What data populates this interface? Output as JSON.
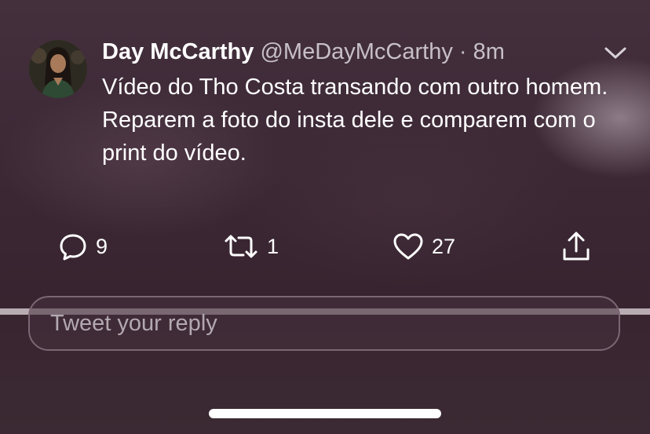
{
  "tweet": {
    "author_name": "Day McCarthy",
    "author_handle": "@MeDayMcCarthy",
    "separator": "·",
    "time": "8m",
    "text": "Vídeo do Tho Costa transando com outro homem. Reparem a foto do insta dele e comparem com o print do vídeo.",
    "avatar_icon": "profile-photo",
    "menu_icon": "chevron-down-icon"
  },
  "actions": {
    "reply": {
      "icon": "reply-icon",
      "count": "9"
    },
    "retweet": {
      "icon": "retweet-icon",
      "count": "1"
    },
    "like": {
      "icon": "heart-icon",
      "count": "27"
    },
    "share": {
      "icon": "share-icon"
    }
  },
  "reply_box": {
    "placeholder": "Tweet your reply"
  },
  "colors": {
    "background": "#3a2633",
    "text": "#ffffff",
    "muted": "#c7c0c6",
    "divider": "#b8acb2"
  }
}
